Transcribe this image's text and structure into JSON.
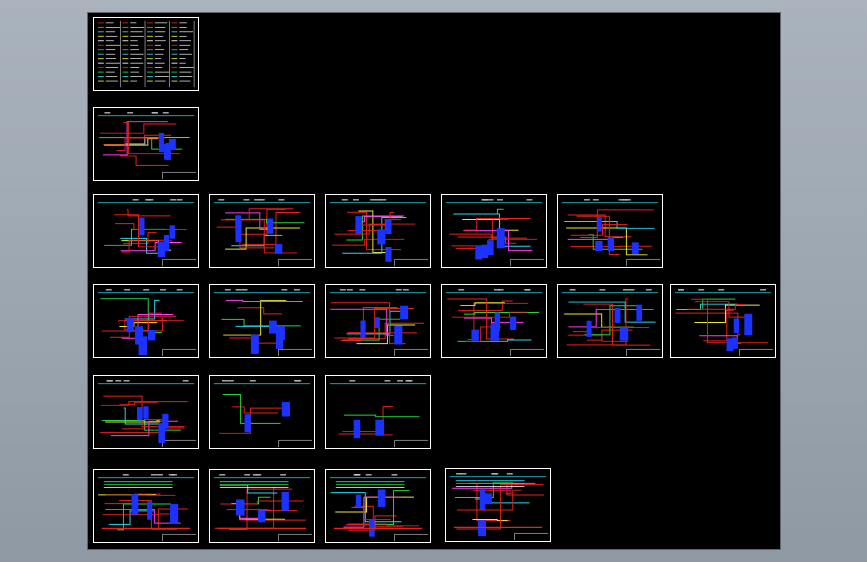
{
  "application": {
    "view": "CAD model space",
    "background_color": "#000000",
    "outer_color": "#9aa3ad"
  },
  "palette": {
    "red": "#e8201a",
    "blue": "#1c33ff",
    "cyan": "#26d7ee",
    "green": "#29d33a",
    "yellow": "#f0e62a",
    "magenta": "#ff3df2",
    "white": "#ffffff"
  },
  "sheets": [
    {
      "kind": "legend"
    },
    {
      "kind": "flow"
    },
    {
      "kind": "flow"
    },
    {
      "kind": "flow"
    },
    {
      "kind": "flow"
    },
    {
      "kind": "flow"
    },
    {
      "kind": "flow"
    },
    {
      "kind": "flow"
    },
    {
      "kind": "exchanger"
    },
    {
      "kind": "flow"
    },
    {
      "kind": "flow"
    },
    {
      "kind": "flow"
    },
    {
      "kind": "flow"
    },
    {
      "kind": "flow"
    },
    {
      "kind": "sparse"
    },
    {
      "kind": "sparse"
    },
    {
      "kind": "station"
    },
    {
      "kind": "station"
    },
    {
      "kind": "station"
    },
    {
      "kind": "station"
    }
  ]
}
